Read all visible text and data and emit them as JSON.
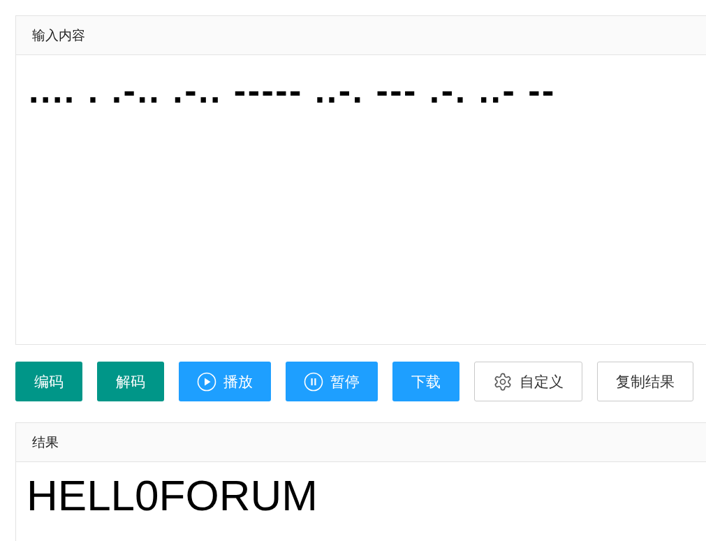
{
  "input_panel": {
    "title": "输入内容",
    "value": ".... . .-.. .-.. ----- ..-. --- .-. ..- --"
  },
  "buttons": [
    {
      "label": "编码",
      "kind": "green"
    },
    {
      "label": "解码",
      "kind": "green"
    },
    {
      "label": "播放",
      "kind": "play"
    },
    {
      "label": "暂停",
      "kind": "pause"
    },
    {
      "label": "下载",
      "kind": "blue"
    },
    {
      "label": "自定义",
      "kind": "gear"
    },
    {
      "label": "复制结果",
      "kind": "plain"
    }
  ],
  "result_panel": {
    "title": "结果",
    "value": "HELL0FORUM"
  }
}
